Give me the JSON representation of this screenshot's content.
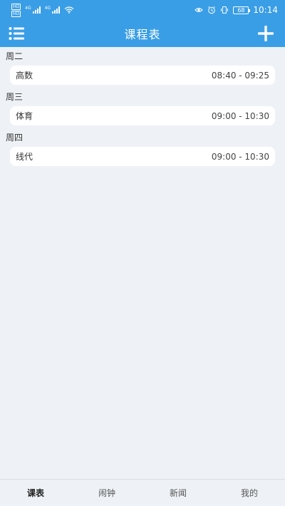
{
  "status_bar": {
    "sim_tags": [
      "HD",
      "HD"
    ],
    "network_labels": [
      "4G",
      "4G"
    ],
    "battery": "68",
    "time": "10:14"
  },
  "app_bar": {
    "title": "课程表",
    "menu_icon": "list-menu-icon",
    "add_icon": "plus-icon"
  },
  "schedule": [
    {
      "day": "周二",
      "course": "高数",
      "time": "08:40 - 09:25"
    },
    {
      "day": "周三",
      "course": "体育",
      "time": "09:00 - 10:30"
    },
    {
      "day": "周四",
      "course": "线代",
      "time": "09:00 - 10:30"
    }
  ],
  "bottom_nav": {
    "items": [
      "课表",
      "闹钟",
      "新闻",
      "我的"
    ],
    "active": "课表"
  },
  "colors": {
    "primary": "#3a9ee6",
    "background": "#eef2f6",
    "card": "#ffffff"
  }
}
